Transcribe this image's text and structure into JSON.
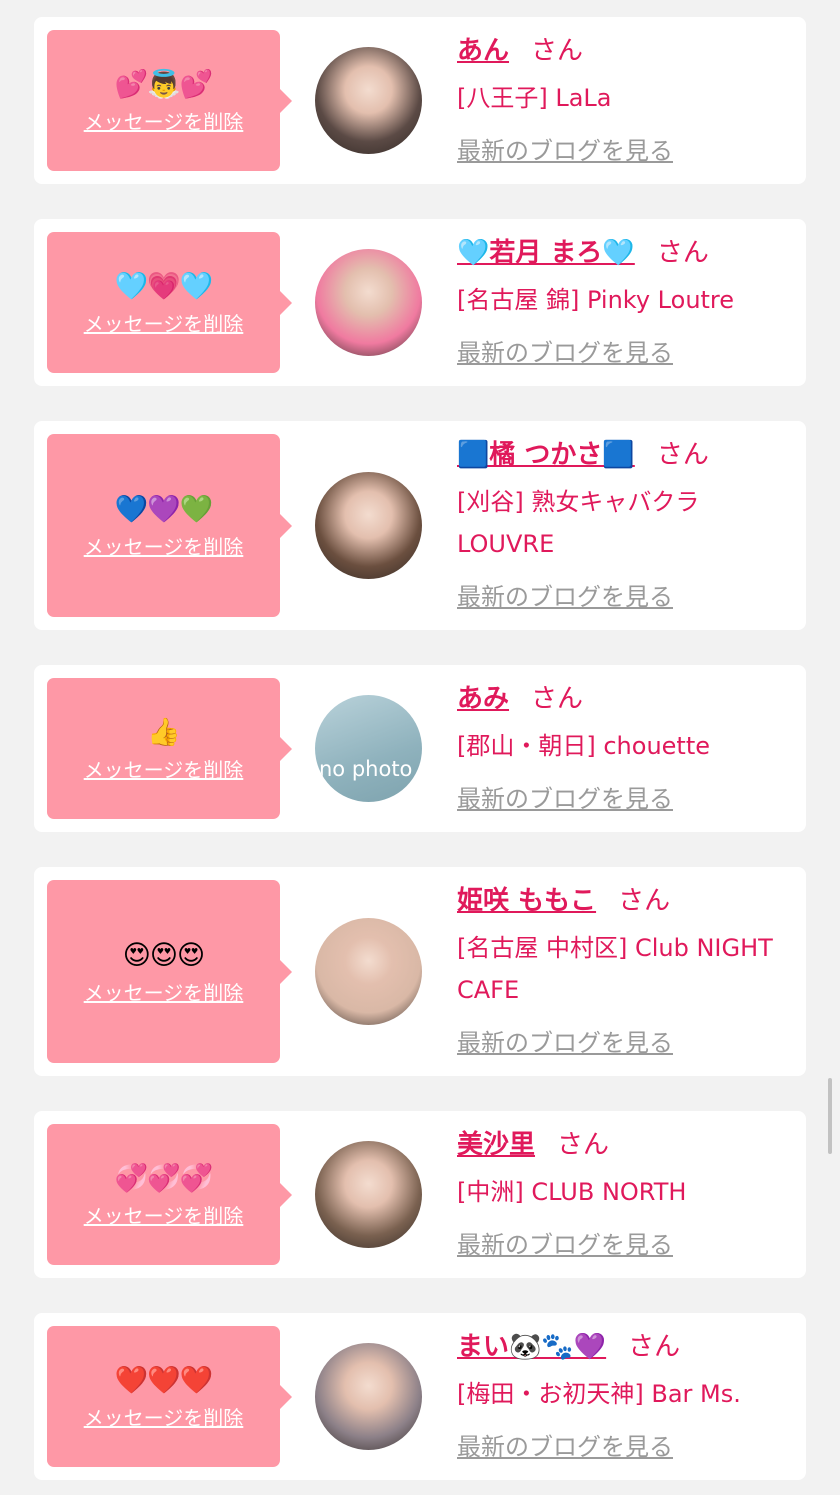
{
  "common": {
    "delete_label": "メッセージを削除",
    "honorific": "さん",
    "blog_label": "最新のブログを見る"
  },
  "colors": {
    "background": "#f2f2f2",
    "card": "#ffffff",
    "bubble": "#fe98a6",
    "accent": "#e0195b",
    "muted_link": "#9a9a9a"
  },
  "entries": [
    {
      "emoji": "💕👼💕",
      "name": "あん",
      "shop": "[八王子] LaLa",
      "avatar_color": "#5b4a45"
    },
    {
      "emoji": "🩵💗🩵",
      "name": "🩵若月 まろ🩵",
      "shop": "[名古屋 錦] Pinky Loutre",
      "avatar_color": "#f07aa0"
    },
    {
      "emoji": "💙💜💚",
      "name": "🟦橘 つかさ🟦",
      "shop": "[刈谷] 熟女キャバクラ LOUVRE",
      "avatar_color": "#6b4f3f"
    },
    {
      "emoji": "👍",
      "name": "あみ",
      "shop": "[郡山・朝日] chouette",
      "avatar_text": "no photo"
    },
    {
      "emoji": "😍😍😍",
      "name": "姫咲 ももこ",
      "shop": "[名古屋 中村区] Club NIGHT CAFE",
      "avatar_color": "#d9b8a6"
    },
    {
      "emoji": "💞💞💞",
      "name": "美沙里",
      "shop": "[中洲] CLUB NORTH",
      "avatar_color": "#7a6150"
    },
    {
      "emoji": "❤️❤️❤️",
      "name": "まい🐼🐾💜",
      "shop": "[梅田・お初天神] Bar Ms.",
      "avatar_color": "#8c8088"
    }
  ]
}
